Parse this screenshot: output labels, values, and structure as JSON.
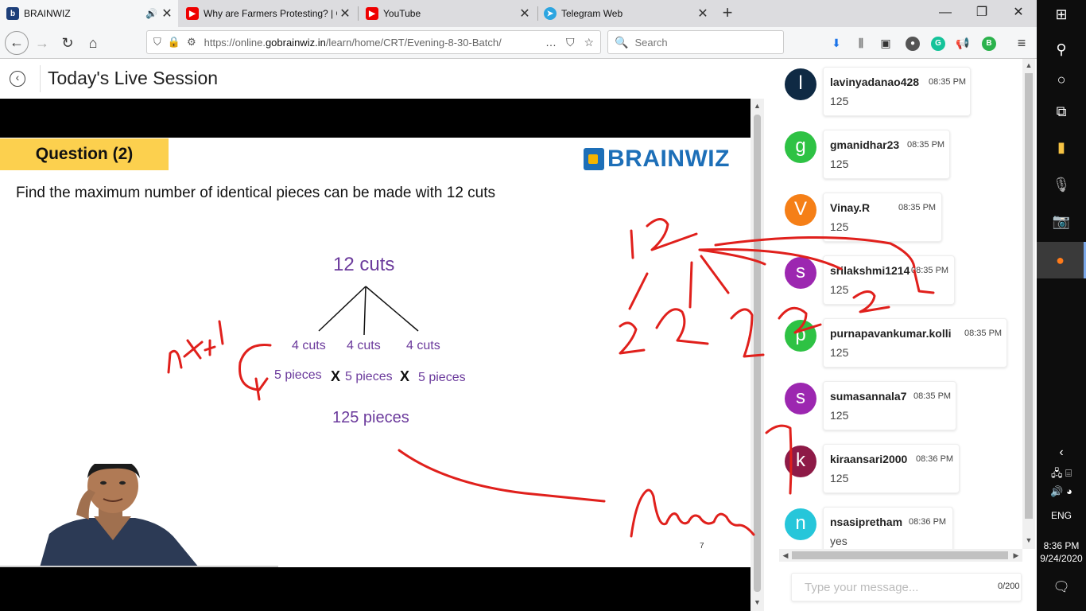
{
  "browser": {
    "tabs": [
      {
        "title": "BRAINWIZ",
        "active": true
      },
      {
        "title": "Why are Farmers Protesting? | C"
      },
      {
        "title": "YouTube"
      },
      {
        "title": "Telegram Web"
      }
    ],
    "url_prefix": "https://online.",
    "url_domain": "gobrainwiz.in",
    "url_path": "/learn/home/CRT/Evening-8-30-Batch/",
    "search_placeholder": "Search",
    "more_icon": "…"
  },
  "page": {
    "title": "Today's Live Session"
  },
  "slide": {
    "question_badge": "Question (2)",
    "brand": "BRAINWIZ",
    "question": "Find the maximum number of identical pieces can be made with 12 cuts",
    "total_cuts": "12 cuts",
    "cut_groups": [
      "4 cuts",
      "4 cuts",
      "4 cuts"
    ],
    "pieces": [
      "5 pieces",
      "5 pieces",
      "5 pieces"
    ],
    "multiply": "X",
    "result": "125 pieces",
    "page_number": "7"
  },
  "chat": {
    "messages": [
      {
        "initial": "l",
        "name": "lavinyadanao428",
        "time": "08:35 PM",
        "text": "125",
        "color": "#0f2a44"
      },
      {
        "initial": "g",
        "name": "gmanidhar23",
        "time": "08:35 PM",
        "text": "125",
        "color": "#2ec244"
      },
      {
        "initial": "V",
        "name": "Vinay.R",
        "time": "08:35 PM",
        "text": "125",
        "color": "#f57f17"
      },
      {
        "initial": "s",
        "name": "srilakshmi1214",
        "time": "08:35 PM",
        "text": "125",
        "color": "#9c27b0"
      },
      {
        "initial": "p",
        "name": "purnapavankumar.kolli",
        "time": "08:35 PM",
        "text": "125",
        "color": "#2ec244"
      },
      {
        "initial": "s",
        "name": "sumasannala7",
        "time": "08:35 PM",
        "text": "125",
        "color": "#9c27b0"
      },
      {
        "initial": "k",
        "name": "kiraansari2000",
        "time": "08:36 PM",
        "text": "125",
        "color": "#8e1a47"
      },
      {
        "initial": "n",
        "name": "nsasipretham",
        "time": "08:36 PM",
        "text": "yes",
        "color": "#26c6da"
      }
    ],
    "input_placeholder": "Type your message...",
    "char_counter": "0/200"
  },
  "taskbar": {
    "lang": "ENG",
    "time": "8:36 PM",
    "date": "9/24/2020"
  }
}
